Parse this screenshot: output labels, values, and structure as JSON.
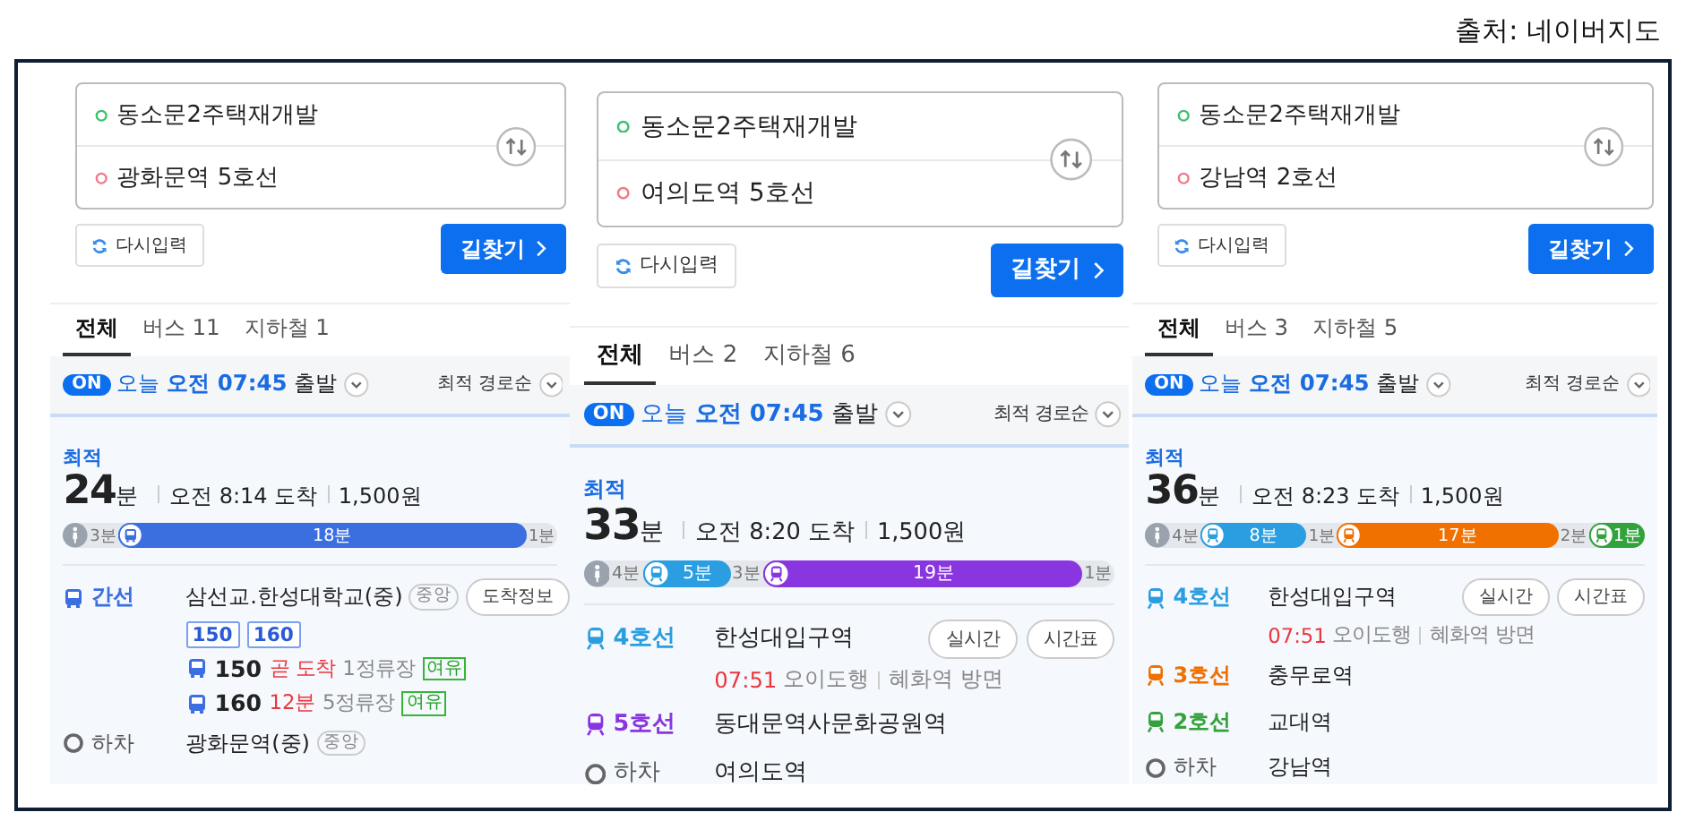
{
  "source": "출처: 네이버지도",
  "panels": [
    {
      "origin": "동소문2주택재개발",
      "destination": "광화문역 5호선",
      "reset_button": "다시입력",
      "search_button": "길찾기",
      "tabs": [
        {
          "label": "전체",
          "selected": true
        },
        {
          "label": "버스 11",
          "selected": false
        },
        {
          "label": "지하철 1",
          "selected": false
        }
      ],
      "departure": {
        "realtime": {
          "label": "ON",
          "on": true
        },
        "day": "오늘",
        "time": "오전 07:45",
        "suffix": "출발"
      },
      "sort": "최적 경로순",
      "route": {
        "badge": "최적",
        "minutes": "24",
        "unit": "분",
        "arrival": "오전 8:14 도착",
        "fare": "1,500원",
        "segments": [
          {
            "kind": "start",
            "label": "3분"
          },
          {
            "kind": "bus",
            "label": "18분",
            "color": "#3b6fe0"
          },
          {
            "kind": "walk",
            "label": "1분"
          }
        ],
        "steps": [
          {
            "kind": "bus",
            "line": "간선",
            "color": "#3b6fe0",
            "station": "삼선교.한성대학교(중)",
            "tag": "중앙",
            "buttons": [
              "도착정보"
            ],
            "routes": [
              "150",
              "160"
            ],
            "arrivals": [
              {
                "number": "150",
                "status": "곧 도착",
                "stops": "1정류장",
                "crowd": "여유"
              },
              {
                "number": "160",
                "status": "12분",
                "stops": "5정류장",
                "crowd": "여유"
              }
            ]
          },
          {
            "kind": "alight",
            "line": "하차",
            "station": "광화문역(중)",
            "tag": "중앙"
          }
        ]
      }
    },
    {
      "origin": "동소문2주택재개발",
      "destination": "여의도역 5호선",
      "reset_button": "다시입력",
      "search_button": "길찾기",
      "tabs": [
        {
          "label": "전체",
          "selected": true
        },
        {
          "label": "버스 2",
          "selected": false
        },
        {
          "label": "지하철 6",
          "selected": false
        }
      ],
      "departure": {
        "realtime": {
          "label": "ON",
          "on": true
        },
        "day": "오늘",
        "time": "오전 07:45",
        "suffix": "출발"
      },
      "sort": "최적 경로순",
      "route": {
        "badge": "최적",
        "minutes": "33",
        "unit": "분",
        "arrival": "오전 8:20 도착",
        "fare": "1,500원",
        "segments": [
          {
            "kind": "start",
            "label": "4분"
          },
          {
            "kind": "subway",
            "label": "5분",
            "color": "#2a9ee0"
          },
          {
            "kind": "walk",
            "label": "3분"
          },
          {
            "kind": "subway",
            "label": "19분",
            "color": "#8936e0"
          },
          {
            "kind": "walk",
            "label": "1분"
          }
        ],
        "steps": [
          {
            "kind": "subway",
            "line": "4호선",
            "color": "#2a9ee0",
            "station": "한성대입구역",
            "buttons": [
              "실시간",
              "시간표"
            ],
            "next": {
              "time": "07:51",
              "direction": "오이도행",
              "exit": "혜화역 방면"
            }
          },
          {
            "kind": "subway",
            "line": "5호선",
            "color": "#8936e0",
            "station": "동대문역사문화공원역"
          },
          {
            "kind": "alight",
            "line": "하차",
            "station": "여의도역"
          }
        ]
      }
    },
    {
      "origin": "동소문2주택재개발",
      "destination": "강남역 2호선",
      "reset_button": "다시입력",
      "search_button": "길찾기",
      "tabs": [
        {
          "label": "전체",
          "selected": true
        },
        {
          "label": "버스 3",
          "selected": false
        },
        {
          "label": "지하철 5",
          "selected": false
        }
      ],
      "departure": {
        "realtime": {
          "label": "ON",
          "on": true
        },
        "day": "오늘",
        "time": "오전 07:45",
        "suffix": "출발"
      },
      "sort": "최적 경로순",
      "route": {
        "badge": "최적",
        "minutes": "36",
        "unit": "분",
        "arrival": "오전 8:23 도착",
        "fare": "1,500원",
        "segments": [
          {
            "kind": "start",
            "label": "4분"
          },
          {
            "kind": "subway",
            "label": "8분",
            "color": "#2a9ee0"
          },
          {
            "kind": "walk",
            "label": "1분"
          },
          {
            "kind": "subway",
            "label": "17분",
            "color": "#f07000"
          },
          {
            "kind": "walk",
            "label": "2분"
          },
          {
            "kind": "subway",
            "label": "1분",
            "color": "#33a23d"
          }
        ],
        "steps": [
          {
            "kind": "subway",
            "line": "4호선",
            "color": "#2a9ee0",
            "station": "한성대입구역",
            "buttons": [
              "실시간",
              "시간표"
            ],
            "next": {
              "time": "07:51",
              "direction": "오이도행",
              "exit": "혜화역 방면"
            }
          },
          {
            "kind": "subway",
            "line": "3호선",
            "color": "#f07000",
            "station": "충무로역"
          },
          {
            "kind": "subway",
            "line": "2호선",
            "color": "#33a23d",
            "station": "교대역"
          },
          {
            "kind": "alight",
            "line": "하차",
            "station": "강남역"
          }
        ]
      }
    }
  ]
}
